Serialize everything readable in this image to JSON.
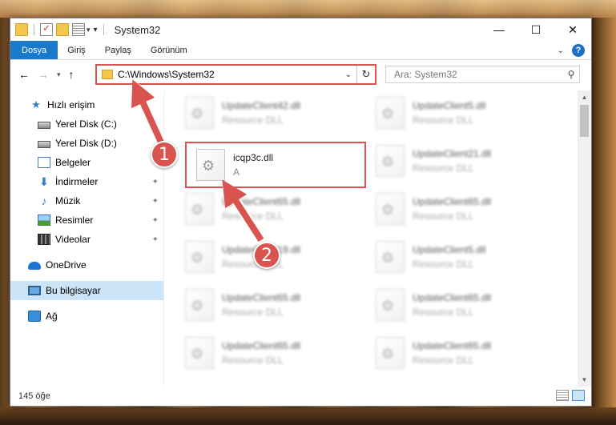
{
  "window": {
    "title": "System32",
    "minimize_glyph": "—",
    "maximize_glyph": "☐",
    "close_glyph": "✕"
  },
  "ribbon": {
    "tabs": [
      "Dosya",
      "Giriş",
      "Paylaş",
      "Görünüm"
    ],
    "help_glyph": "?"
  },
  "address": {
    "path": "C:\\Windows\\System32",
    "search_placeholder": "Ara: System32"
  },
  "sidebar": {
    "items": [
      {
        "label": "Hızlı erişim",
        "icon": "star-icon"
      },
      {
        "label": "Yerel Disk (C:)",
        "icon": "drive-icon"
      },
      {
        "label": "Yerel Disk (D:)",
        "icon": "drive-icon"
      },
      {
        "label": "Belgeler",
        "icon": "documents-icon"
      },
      {
        "label": "İndirmeler",
        "icon": "download-icon"
      },
      {
        "label": "Müzik",
        "icon": "music-icon"
      },
      {
        "label": "Resimler",
        "icon": "pictures-icon"
      },
      {
        "label": "Videolar",
        "icon": "videos-icon"
      },
      {
        "label": "OneDrive",
        "icon": "cloud-icon"
      },
      {
        "label": "Bu bilgisayar",
        "icon": "computer-icon"
      },
      {
        "label": "Ağ",
        "icon": "network-icon"
      }
    ]
  },
  "files": {
    "highlighted": {
      "name": "icqp3c.dll",
      "type": "A"
    },
    "items": [
      {
        "name": "UpdateClient42.dll",
        "type": "Resource DLL"
      },
      {
        "name": "UpdateClient5.dll",
        "type": "Resource DLL"
      },
      {
        "name": "UpdateClient21.dll",
        "type": "Resource DLL"
      },
      {
        "name": "UpdateClient65.dll",
        "type": "Resource DLL"
      },
      {
        "name": "UpdateClient65.dll",
        "type": "Resource DLL"
      },
      {
        "name": "UpdateClient19.dll",
        "type": "Resource DLL"
      },
      {
        "name": "UpdateClient5.dll",
        "type": "Resource DLL"
      },
      {
        "name": "UpdateClient65.dll",
        "type": "Resource DLL"
      },
      {
        "name": "UpdateClient65.dll",
        "type": "Resource DLL"
      },
      {
        "name": "UpdateClient65.dll",
        "type": "Resource DLL"
      },
      {
        "name": "UpdateClient65.dll",
        "type": "Resource DLL"
      }
    ]
  },
  "status": {
    "item_count": "145 öğe"
  },
  "annotations": {
    "step1": "1",
    "step2": "2",
    "accent": "#d9534f"
  }
}
